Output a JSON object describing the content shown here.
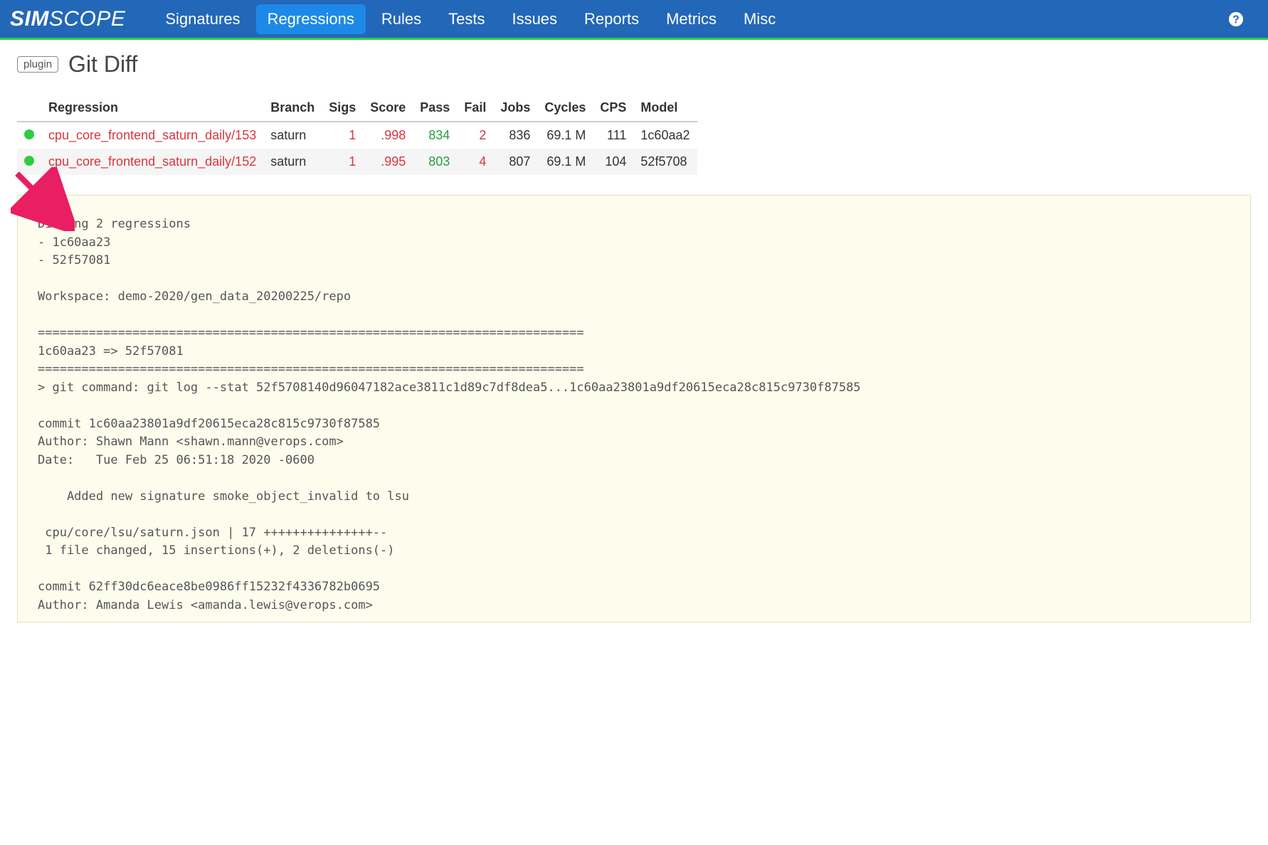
{
  "logo": {
    "part1": "SIM",
    "part2": "SCOPE"
  },
  "nav": {
    "items": [
      {
        "label": "Signatures",
        "active": false
      },
      {
        "label": "Regressions",
        "active": true
      },
      {
        "label": "Rules",
        "active": false
      },
      {
        "label": "Tests",
        "active": false
      },
      {
        "label": "Issues",
        "active": false
      },
      {
        "label": "Reports",
        "active": false
      },
      {
        "label": "Metrics",
        "active": false
      },
      {
        "label": "Misc",
        "active": false
      }
    ]
  },
  "page": {
    "plugin_badge": "plugin",
    "title": "Git Diff"
  },
  "reg_table": {
    "headers": {
      "regression": "Regression",
      "branch": "Branch",
      "sigs": "Sigs",
      "score": "Score",
      "pass": "Pass",
      "fail": "Fail",
      "jobs": "Jobs",
      "cycles": "Cycles",
      "cps": "CPS",
      "model": "Model"
    },
    "rows": [
      {
        "name": "cpu_core_frontend_saturn_daily/153",
        "branch": "saturn",
        "sigs": "1",
        "score": ".998",
        "pass": "834",
        "fail": "2",
        "jobs": "836",
        "cycles": "69.1 M",
        "cps": "111",
        "model": "1c60aa2"
      },
      {
        "name": "cpu_core_frontend_saturn_daily/152",
        "branch": "saturn",
        "sigs": "1",
        "score": ".995",
        "pass": "803",
        "fail": "4",
        "jobs": "807",
        "cycles": "69.1 M",
        "cps": "104",
        "model": "52f5708"
      }
    ]
  },
  "diff_output": "Diffing 2 regressions\n- 1c60aa23\n- 52f57081\n\nWorkspace: demo-2020/gen_data_20200225/repo\n\n===========================================================================\n1c60aa23 => 52f57081\n===========================================================================\n> git command: git log --stat 52f5708140d96047182ace3811c1d89c7df8dea5...1c60aa23801a9df20615eca28c815c9730f87585\n\ncommit 1c60aa23801a9df20615eca28c815c9730f87585\nAuthor: Shawn Mann <shawn.mann@verops.com>\nDate:   Tue Feb 25 06:51:18 2020 -0600\n\n    Added new signature smoke_object_invalid to lsu\n\n cpu/core/lsu/saturn.json | 17 +++++++++++++++--\n 1 file changed, 15 insertions(+), 2 deletions(-)\n\ncommit 62ff30dc6eace8be0986ff15232f4336782b0695\nAuthor: Amanda Lewis <amanda.lewis@verops.com>"
}
